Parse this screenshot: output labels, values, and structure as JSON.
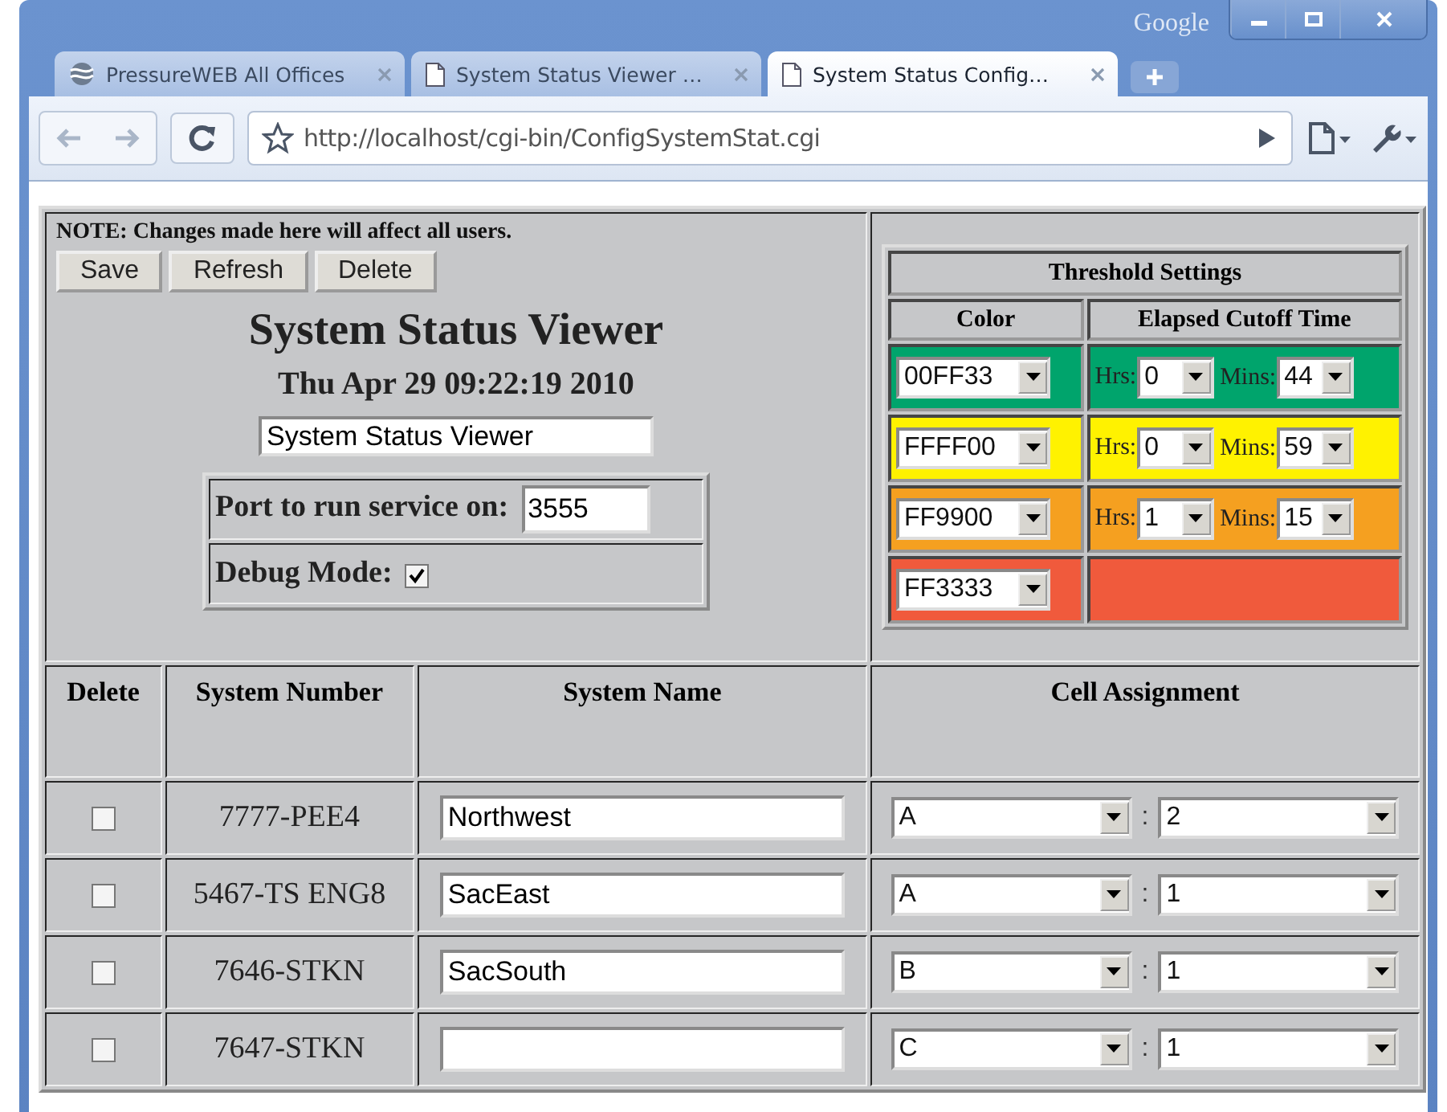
{
  "browser": {
    "brand": "Google",
    "tabs": [
      {
        "title": "PressureWEB All Offices",
        "selected": false,
        "kind": "logo"
      },
      {
        "title": "System Status Viewer …",
        "selected": false,
        "kind": "page"
      },
      {
        "title": "System Status Config…",
        "selected": true,
        "kind": "page"
      }
    ],
    "address": "http://localhost/cgi-bin/ConfigSystemStat.cgi"
  },
  "config": {
    "note": "NOTE: Changes made here will affect all users.",
    "buttons": [
      "Save",
      "Refresh",
      "Delete"
    ],
    "heading": "System Status Viewer",
    "datetime": "Thu Apr 29 09:22:19 2010",
    "title_field": "System Status Viewer",
    "port_label": "Port to run service on:",
    "port": "3555",
    "debug_label": "Debug Mode:",
    "debug_checked": true
  },
  "threshold": {
    "title": "Threshold Settings",
    "columns": [
      "Color",
      "Elapsed Cutoff Time"
    ],
    "rows": [
      {
        "color": "#00a46c",
        "value": "00FF33",
        "hrs_label": "Hrs:",
        "hrs": "0",
        "mins_label": "Mins:",
        "mins": "44"
      },
      {
        "color": "#fff200",
        "value": "FFFF00",
        "hrs_label": "Hrs:",
        "hrs": "0",
        "mins_label": "Mins:",
        "mins": "59"
      },
      {
        "color": "#f5a020",
        "value": "FF9900",
        "hrs_label": "Hrs:",
        "hrs": "1",
        "mins_label": "Mins:",
        "mins": "15"
      },
      {
        "color": "#f05a3c",
        "value": "FF3333"
      }
    ]
  },
  "systems": {
    "columns": [
      "Delete",
      "System Number",
      "System Name",
      "Cell Assignment"
    ],
    "rows": [
      {
        "checked": false,
        "number": "7777-PEE4",
        "name": "Northwest",
        "cell": "A",
        "separator": ":",
        "slot": "2"
      },
      {
        "checked": false,
        "number": "5467-TS ENG8",
        "name": "SacEast",
        "cell": "A",
        "separator": ":",
        "slot": "1"
      },
      {
        "checked": false,
        "number": "7646-STKN",
        "name": "SacSouth",
        "cell": "B",
        "separator": ":",
        "slot": "1"
      },
      {
        "checked": false,
        "number": "7647-STKN",
        "cell": "C",
        "separator": ":",
        "slot": "1"
      }
    ]
  }
}
